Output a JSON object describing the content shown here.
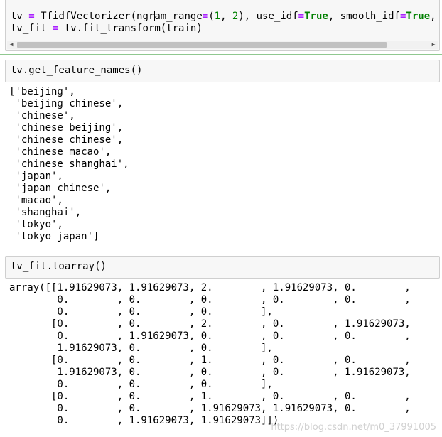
{
  "cell1": {
    "line1": {
      "a": "tv ",
      "eq": "=",
      "b": " TfidfVectorizer(ngr",
      "c": "am_range",
      "eq2": "=",
      "d": "(",
      "n1": "1",
      "e": ", ",
      "n2": "2",
      "f": "), use_idf",
      "eq3": "=",
      "t1": "True",
      "g": ", smooth_idf",
      "eq4": "=",
      "t2": "True",
      "h": ","
    },
    "line2": {
      "a": "tv_fit ",
      "eq": "=",
      "b": " tv.fit_transform(train)"
    }
  },
  "cell2": {
    "code": "tv.get_feature_names()",
    "output": [
      "['beijing',",
      " 'beijing chinese',",
      " 'chinese',",
      " 'chinese beijing',",
      " 'chinese chinese',",
      " 'chinese macao',",
      " 'chinese shanghai',",
      " 'japan',",
      " 'japan chinese',",
      " 'macao',",
      " 'shanghai',",
      " 'tokyo',",
      " 'tokyo japan']"
    ]
  },
  "cell3": {
    "code": "tv_fit.toarray()",
    "output": [
      "array([[1.91629073, 1.91629073, 2.        , 1.91629073, 0.        ,",
      "        0.        , 0.        , 0.        , 0.        , 0.        ,",
      "        0.        , 0.        , 0.        ],",
      "       [0.        , 0.        , 2.        , 0.        , 1.91629073,",
      "        0.        , 1.91629073, 0.        , 0.        , 0.        ,",
      "        1.91629073, 0.        , 0.        ],",
      "       [0.        , 0.        , 1.        , 0.        , 0.        ,",
      "        1.91629073, 0.        , 0.        , 0.        , 1.91629073,",
      "        0.        , 0.        , 0.        ],",
      "       [0.        , 0.        , 1.        , 0.        , 0.        ,",
      "        0.        , 0.        , 1.91629073, 1.91629073, 0.        ,",
      "        0.        , 1.91629073, 1.91629073]])"
    ]
  },
  "watermark": "https://blog.csdn.net/m0_37991005"
}
